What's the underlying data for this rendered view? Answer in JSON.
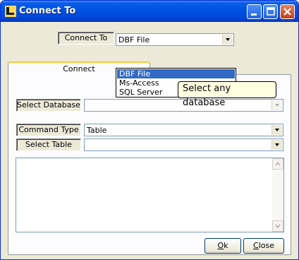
{
  "window": {
    "title": "Connect To"
  },
  "connect_to": {
    "label": "Connect To",
    "value": "DBF File"
  },
  "dropdown": {
    "options": [
      "DBF File",
      "Ms-Access",
      "SQL Server"
    ],
    "selected": "DBF File"
  },
  "tooltip": {
    "text": "Select any database"
  },
  "tab": {
    "label": "Connect"
  },
  "select_database": {
    "label": "Select Database",
    "value": ""
  },
  "command_type": {
    "label": "Command Type",
    "value": "Table"
  },
  "select_table": {
    "label": "Select Table",
    "value": ""
  },
  "buttons": {
    "ok": "k",
    "ok_mnemonic": "O",
    "close": "lose",
    "close_mnemonic": "C"
  }
}
